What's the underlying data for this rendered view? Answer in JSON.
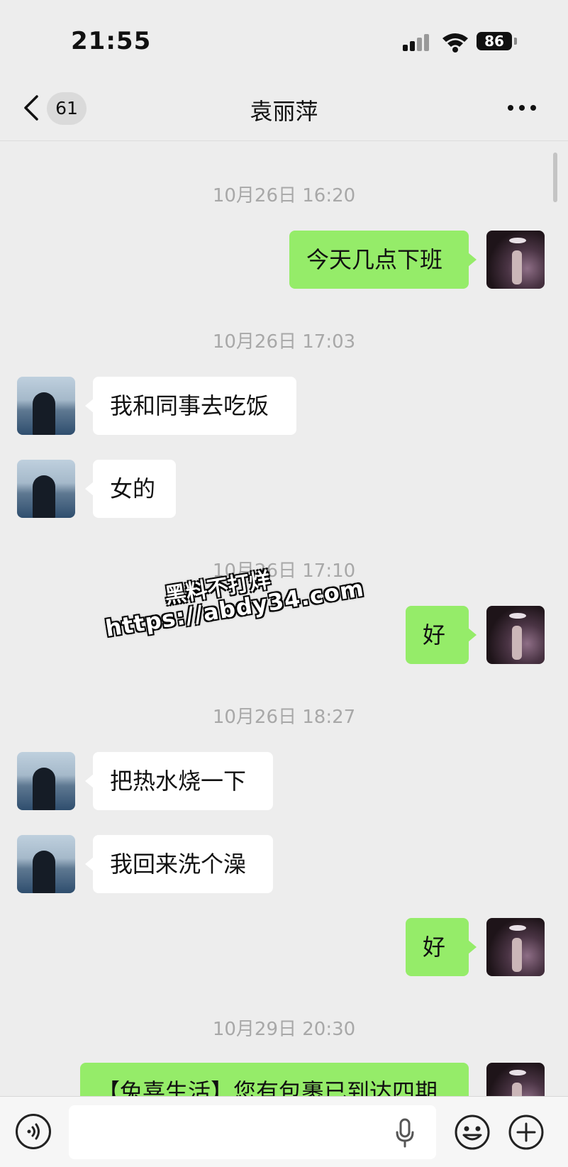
{
  "status_bar": {
    "time": "21:55",
    "battery": "86"
  },
  "nav": {
    "unread_count": "61",
    "title": "袁丽萍"
  },
  "messages": [
    {
      "type": "time",
      "text": "10月26日 16:20"
    },
    {
      "type": "sent",
      "text": "今天几点下班"
    },
    {
      "type": "time",
      "text": "10月26日 17:03"
    },
    {
      "type": "received",
      "text": "我和同事去吃饭"
    },
    {
      "type": "received",
      "text": "女的"
    },
    {
      "type": "time",
      "text": "10月26日 17:10"
    },
    {
      "type": "sent",
      "text": "好"
    },
    {
      "type": "time",
      "text": "10月26日 18:27"
    },
    {
      "type": "received",
      "text": "把热水烧一下"
    },
    {
      "type": "received",
      "text": "我回来洗个澡"
    },
    {
      "type": "sent",
      "text": "好"
    },
    {
      "type": "time",
      "text": "10月29日 20:30"
    },
    {
      "type": "sent",
      "text": "【兔喜生活】您有包裹已到达四期"
    }
  ],
  "watermark": {
    "line1": "黑料不打烊",
    "line2": "https://abdy34.com"
  },
  "input": {
    "placeholder": ""
  },
  "colors": {
    "sent_bubble": "#95ec69",
    "received_bubble": "#ffffff",
    "background": "#ededed",
    "timestamp": "#a8a8a8"
  },
  "icons": [
    "back-icon",
    "more-icon",
    "voice-icon",
    "mic-icon",
    "emoji-icon",
    "plus-icon"
  ]
}
